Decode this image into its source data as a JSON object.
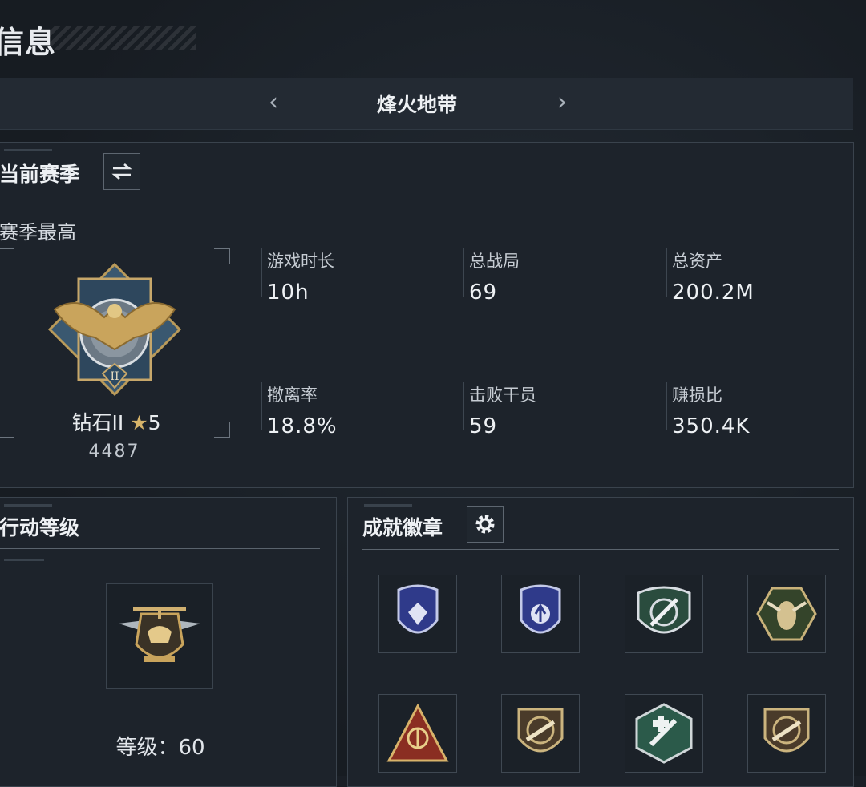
{
  "page": {
    "title": "信息"
  },
  "mode_selector": {
    "prev_icon": "chevron-left-icon",
    "label": "烽火地带",
    "next_icon": "chevron-right-icon"
  },
  "season_panel": {
    "header": "当前赛季",
    "switch_icon": "swap-arrows-icon",
    "subheader": "赛季最高",
    "rank": {
      "name": "钻石II",
      "star_icon": "star-icon",
      "stars": "5",
      "score": "4487",
      "emblem_icon": "eagle-rank-emblem-icon"
    },
    "stats": [
      {
        "label": "游戏时长",
        "value": "10h"
      },
      {
        "label": "总战局",
        "value": "69"
      },
      {
        "label": "总资产",
        "value": "200.2M"
      },
      {
        "label": "撤离率",
        "value": "18.8%"
      },
      {
        "label": "击败干员",
        "value": "59"
      },
      {
        "label": "赚损比",
        "value": "350.4K"
      }
    ]
  },
  "operation_panel": {
    "header": "行动等级",
    "emblem_icon": "helicopter-emblem-icon",
    "level_text": "等级：60"
  },
  "badges_panel": {
    "header": "成就徽章",
    "settings_icon": "gear-icon",
    "badges": [
      {
        "icon": "diamond-shield-badge-icon"
      },
      {
        "icon": "arrow-shield-badge-icon"
      },
      {
        "icon": "missile-crest-badge-icon"
      },
      {
        "icon": "wasp-hexagon-badge-icon"
      },
      {
        "icon": "satellite-triangle-badge-icon"
      },
      {
        "icon": "rifle-shield-badge-icon"
      },
      {
        "icon": "medic-hexagon-badge-icon"
      },
      {
        "icon": "rifle-shield-badge-icon"
      }
    ]
  },
  "colors": {
    "background": "#1a1f26",
    "panel": "#1d232b",
    "border": "#3a434d",
    "gold": "#d7b46a"
  }
}
